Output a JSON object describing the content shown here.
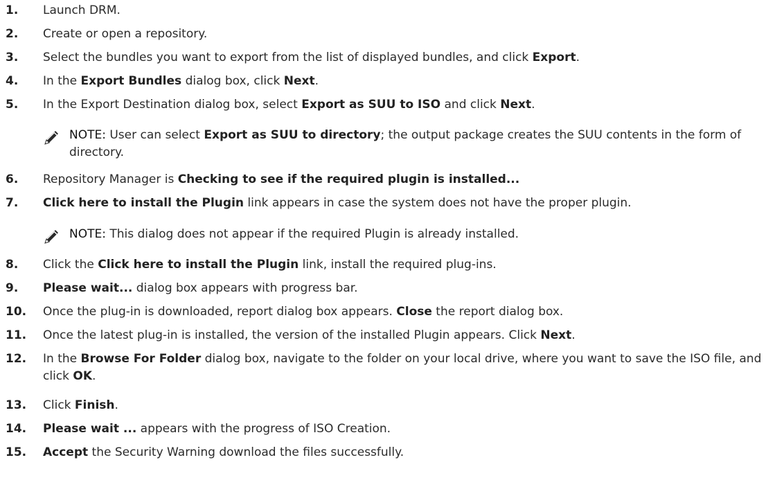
{
  "steps": [
    {
      "n": "1.",
      "parts": [
        [
          "Launch DRM.",
          false
        ]
      ]
    },
    {
      "n": "2.",
      "parts": [
        [
          "Create or open a repository.",
          false
        ]
      ]
    },
    {
      "n": "3.",
      "parts": [
        [
          "Select the bundles you want to export from the list of displayed bundles, and click ",
          false
        ],
        [
          "Export",
          true
        ],
        [
          ".",
          false
        ]
      ]
    },
    {
      "n": "4.",
      "parts": [
        [
          "In the ",
          false
        ],
        [
          "Export Bundles",
          true
        ],
        [
          " dialog box, click ",
          false
        ],
        [
          "Next",
          true
        ],
        [
          ".",
          false
        ]
      ]
    },
    {
      "n": "5.",
      "parts": [
        [
          "In the Export Destination dialog box, select ",
          false
        ],
        [
          "Export as SUU to ISO",
          true
        ],
        [
          " and click ",
          false
        ],
        [
          "Next",
          true
        ],
        [
          ".",
          false
        ]
      ]
    },
    {
      "n": "6.",
      "parts": [
        [
          "Repository Manager is ",
          false
        ],
        [
          "Checking to see if the required plugin is installed...",
          true
        ]
      ]
    },
    {
      "n": "7.",
      "parts": [
        [
          "Click here to install the Plugin",
          true
        ],
        [
          " link appears in case the system does not have the proper plugin.",
          false
        ]
      ]
    },
    {
      "n": "8.",
      "parts": [
        [
          "Click the ",
          false
        ],
        [
          "Click here to install the Plugin",
          true
        ],
        [
          " link, install the required plug-ins.",
          false
        ]
      ]
    },
    {
      "n": "9.",
      "parts": [
        [
          "Please wait...",
          true
        ],
        [
          " dialog box appears with progress bar.",
          false
        ]
      ]
    },
    {
      "n": "10.",
      "parts": [
        [
          "Once the plug-in is downloaded, report dialog box appears. ",
          false
        ],
        [
          "Close",
          true
        ],
        [
          " the report dialog box.",
          false
        ]
      ]
    },
    {
      "n": "11.",
      "parts": [
        [
          "Once the latest plug-in is installed, the version of the installed Plugin appears. Click ",
          false
        ],
        [
          "Next",
          true
        ],
        [
          ".",
          false
        ]
      ]
    },
    {
      "n": "12.",
      "parts": [
        [
          "In the ",
          false
        ],
        [
          "Browse For Folder",
          true
        ],
        [
          " dialog box, navigate to the folder on your local drive, where you want to save the ISO file, and click ",
          false
        ],
        [
          "OK",
          true
        ],
        [
          ".",
          false
        ]
      ]
    },
    {
      "n": "13.",
      "parts": [
        [
          "Click ",
          false
        ],
        [
          "Finish",
          true
        ],
        [
          ".",
          false
        ]
      ]
    },
    {
      "n": "14.",
      "parts": [
        [
          "Please wait ...",
          true
        ],
        [
          " appears with the progress of ISO Creation.",
          false
        ]
      ]
    },
    {
      "n": "15.",
      "parts": [
        [
          "Accept",
          true
        ],
        [
          " the Security Warning download the files successfully.",
          false
        ]
      ]
    }
  ],
  "notes": [
    {
      "label": "NOTE:",
      "parts": [
        [
          " User can select ",
          false
        ],
        [
          "Export as SUU to directory",
          true
        ],
        [
          "; the output package creates the SUU contents in the form of directory.",
          false
        ]
      ]
    },
    {
      "label": "NOTE:",
      "parts": [
        [
          " This dialog does not appear if the required Plugin is already installed.",
          false
        ]
      ]
    }
  ],
  "icons": {
    "note": "pencil-note-icon"
  }
}
